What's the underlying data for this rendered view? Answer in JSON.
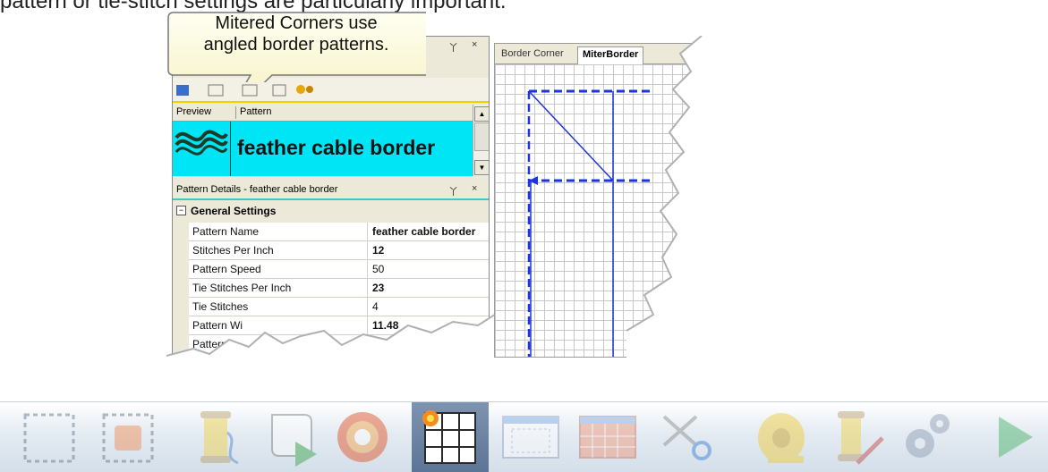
{
  "cropped_caption": "pattern or tie-stitch settings are particularly important.",
  "callout": {
    "line1": "Mitered Corners use",
    "line2": "angled border patterns."
  },
  "left_panel": {
    "top_title_buttons": [
      "ᵖ",
      "×"
    ],
    "list": {
      "col_preview": "Preview",
      "col_pattern": "Pattern",
      "selected_row": "feather cable border"
    },
    "details_title": "Pattern Details - feather cable border",
    "group": "General Settings",
    "rows": [
      {
        "k": "Pattern Name",
        "v": "feather cable border"
      },
      {
        "k": "Stitches Per Inch",
        "v": "12"
      },
      {
        "k": "Pattern Speed",
        "v": "50"
      },
      {
        "k": "Tie Stitches Per Inch",
        "v": "23"
      },
      {
        "k": "Tie Stitches",
        "v": "4"
      },
      {
        "k": "Pattern Wi",
        "v": "11.48"
      },
      {
        "k": "Pattern",
        "v": ""
      }
    ]
  },
  "right_panel": {
    "tabs": [
      "Border Corner",
      "MiterBorder"
    ],
    "active_tab": "MiterBorder"
  },
  "toolbar_icons": [
    "select-rect-icon",
    "select-fill-icon",
    "thread-spool-icon",
    "scroll-play-icon",
    "target-icon",
    "mitered-corner-icon",
    "border-grid-icon",
    "block-grid-icon",
    "scissors-icon",
    "tape-measure-icon",
    "thread-edit-icon",
    "settings-gears-icon",
    "play-icon"
  ],
  "colors": {
    "selected_row": "#00e5f5",
    "accent_yellow": "#f2d000",
    "line_blue": "#1c35e0",
    "toolbar_selected": "#5c7596"
  }
}
